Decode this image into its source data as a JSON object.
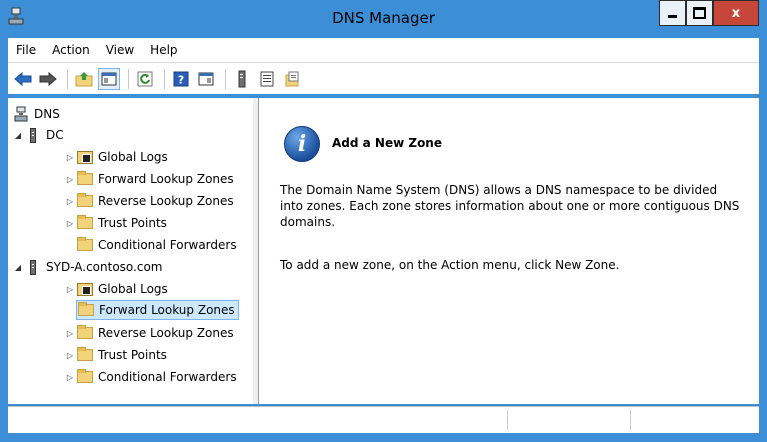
{
  "window": {
    "title": "DNS Manager",
    "close_label": "x",
    "colors": {
      "frame": "#3c8fd6",
      "close": "#c7463a"
    }
  },
  "menu": [
    "File",
    "Action",
    "View",
    "Help"
  ],
  "toolbar": {
    "buttons": [
      "back-icon",
      "forward-icon",
      "up-folder-icon",
      "show-hide-console-tree-icon",
      "refresh-icon",
      "help-icon",
      "show-hide-action-pane-icon",
      "server-icon",
      "list-icon",
      "new-zone-icon"
    ]
  },
  "tree": {
    "root": "DNS",
    "nodes": [
      {
        "label": "DC",
        "expanded": true
      },
      {
        "label": "Global Logs"
      },
      {
        "label": "Forward Lookup Zones"
      },
      {
        "label": "Reverse Lookup Zones"
      },
      {
        "label": "Trust Points"
      },
      {
        "label": "Conditional Forwarders"
      },
      {
        "label": "SYD-A.contoso.com",
        "expanded": true
      },
      {
        "label": "Global Logs"
      },
      {
        "label": "Forward Lookup Zones",
        "selected": true
      },
      {
        "label": "Reverse Lookup Zones"
      },
      {
        "label": "Trust Points"
      },
      {
        "label": "Conditional Forwarders"
      }
    ]
  },
  "info": {
    "title": "Add a New Zone",
    "p1": "The Domain Name System (DNS) allows a DNS namespace to be divided into zones. Each zone stores information about one or more contiguous DNS domains.",
    "p2": "To add a new zone, on the Action menu, click New Zone."
  }
}
